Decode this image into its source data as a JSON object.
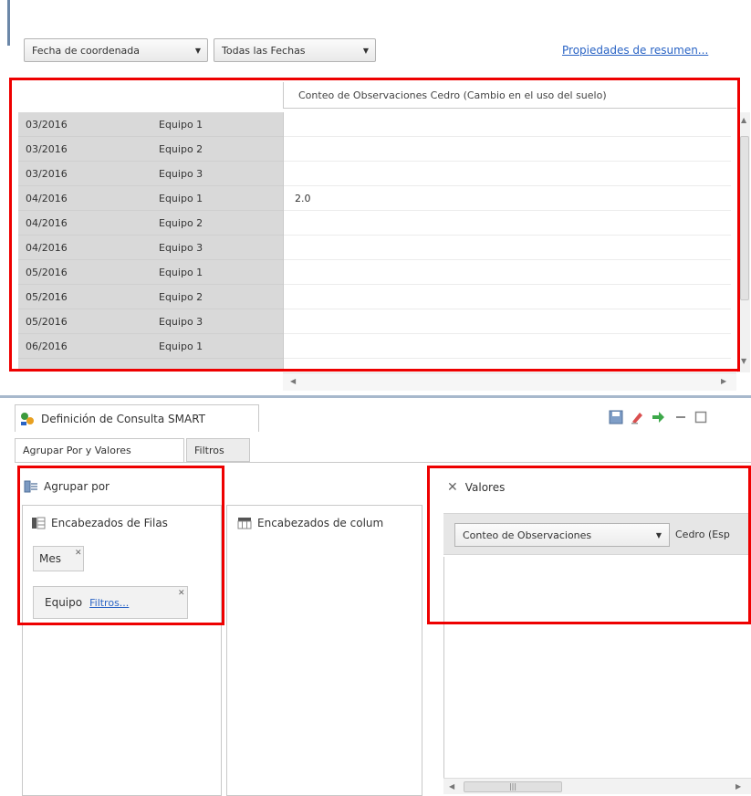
{
  "toolbar": {
    "date_field": "Fecha de coordenada",
    "date_range": "Todas las Fechas",
    "summary_link": "Propiedades de resumen..."
  },
  "table": {
    "header": "Conteo de Observaciones  Cedro (Cambio en el uso del suelo)",
    "rows": [
      {
        "month": "03/2016",
        "team": "Equipo 1",
        "value": ""
      },
      {
        "month": "03/2016",
        "team": "Equipo 2",
        "value": ""
      },
      {
        "month": "03/2016",
        "team": "Equipo 3",
        "value": ""
      },
      {
        "month": "04/2016",
        "team": "Equipo 1",
        "value": "2.0"
      },
      {
        "month": "04/2016",
        "team": "Equipo 2",
        "value": ""
      },
      {
        "month": "04/2016",
        "team": "Equipo 3",
        "value": ""
      },
      {
        "month": "05/2016",
        "team": "Equipo 1",
        "value": ""
      },
      {
        "month": "05/2016",
        "team": "Equipo 2",
        "value": ""
      },
      {
        "month": "05/2016",
        "team": "Equipo 3",
        "value": ""
      },
      {
        "month": "06/2016",
        "team": "Equipo 1",
        "value": ""
      }
    ]
  },
  "panel": {
    "title": "Definición de Consulta SMART",
    "tabs": {
      "group_values": "Agrupar Por y Valores",
      "filters": "Filtros"
    },
    "group_by": {
      "title": "Agrupar por",
      "row_headers": "Encabezados de Filas",
      "column_headers": "Encabezados de colum",
      "chips": {
        "month": "Mes",
        "team": "Equipo",
        "team_filter_link": "Filtros..."
      }
    },
    "values": {
      "title": "Valores",
      "measure": "Conteo de Observaciones",
      "species": "Cedro (Esp"
    }
  },
  "icons": {
    "panel": "smart-query-icon",
    "group_by": "group-by-icon",
    "row_headers": "row-headers-icon",
    "column_headers": "column-headers-icon",
    "values": "values-x-icon"
  },
  "colors": {
    "highlight": "#ee0000",
    "link": "#2a64c5",
    "row_header_bg": "#d9d9d9"
  }
}
